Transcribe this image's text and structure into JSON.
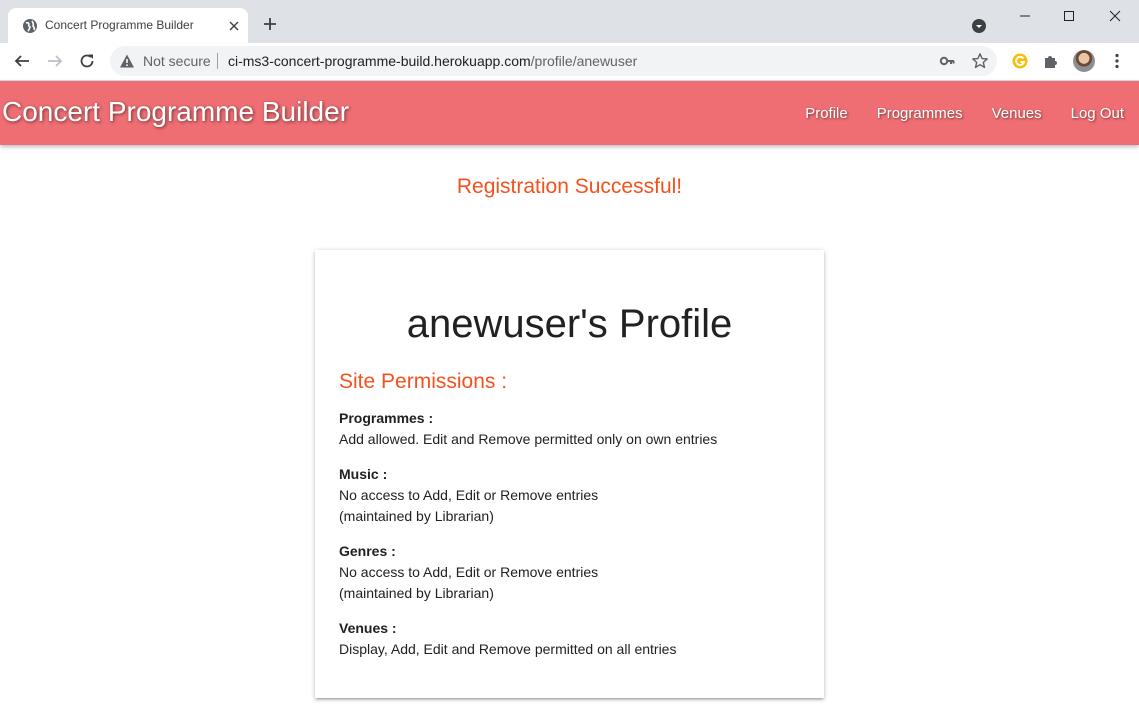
{
  "browser": {
    "tab_title": "Concert Programme Builder",
    "security_label": "Not secure",
    "url_host": "ci-ms3-concert-programme-build.herokuapp.com",
    "url_path": "/profile/anewuser"
  },
  "site": {
    "brand": "Concert Programme Builder",
    "accent_color": "#ee6e73",
    "nav": [
      "Profile",
      "Programmes",
      "Venues",
      "Log Out"
    ]
  },
  "flash_message": "Registration Successful!",
  "profile": {
    "title": "anewuser's Profile",
    "permissions_heading": "Site Permissions :",
    "permissions": [
      {
        "label": "Programmes :",
        "lines": [
          "Add allowed. Edit and Remove permitted only on own entries"
        ]
      },
      {
        "label": "Music :",
        "lines": [
          "No access to Add, Edit or Remove entries",
          "(maintained by Librarian)"
        ]
      },
      {
        "label": "Genres :",
        "lines": [
          "No access to Add, Edit or Remove entries",
          "(maintained by Librarian)"
        ]
      },
      {
        "label": "Venues :",
        "lines": [
          "Display, Add, Edit and Remove permitted on all entries"
        ]
      }
    ]
  }
}
